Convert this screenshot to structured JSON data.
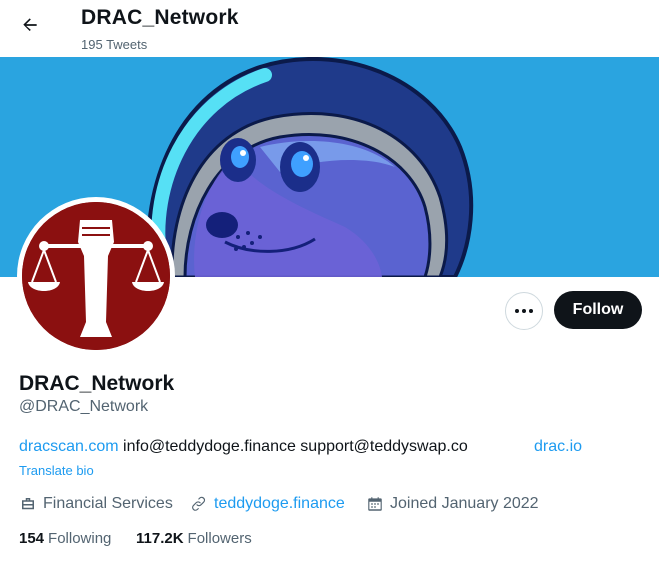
{
  "header": {
    "back_icon": "arrow-left-icon",
    "title": "DRAC_Network",
    "tweet_count": "195 Tweets"
  },
  "banner": {
    "description_colors": {
      "sky": "#2aa4e0",
      "helmet": "#1f3a8a",
      "visor": "#6a6fd6"
    }
  },
  "avatar": {
    "color": "#8b1010",
    "icon": "scales-fist-icon"
  },
  "actions": {
    "more_icon": "more-dots-icon",
    "follow_label": "Follow"
  },
  "profile": {
    "name": "DRAC_Network",
    "handle": "@DRAC_Network",
    "bio": {
      "link1": "dracscan.com",
      "text": "info@teddydoge.finance support@teddyswap.co",
      "link2": "drac.io"
    },
    "translate_label": "Translate bio",
    "category": "Financial Services",
    "website": "teddydoge.finance",
    "joined": "Joined January 2022"
  },
  "stats": {
    "following_count": "154",
    "following_label": "Following",
    "followers_count": "117.2K",
    "followers_label": "Followers"
  },
  "colors": {
    "accent": "#1d9bf0",
    "text": "#0f1419",
    "muted": "#536471",
    "follow_bg": "#0f1419"
  }
}
